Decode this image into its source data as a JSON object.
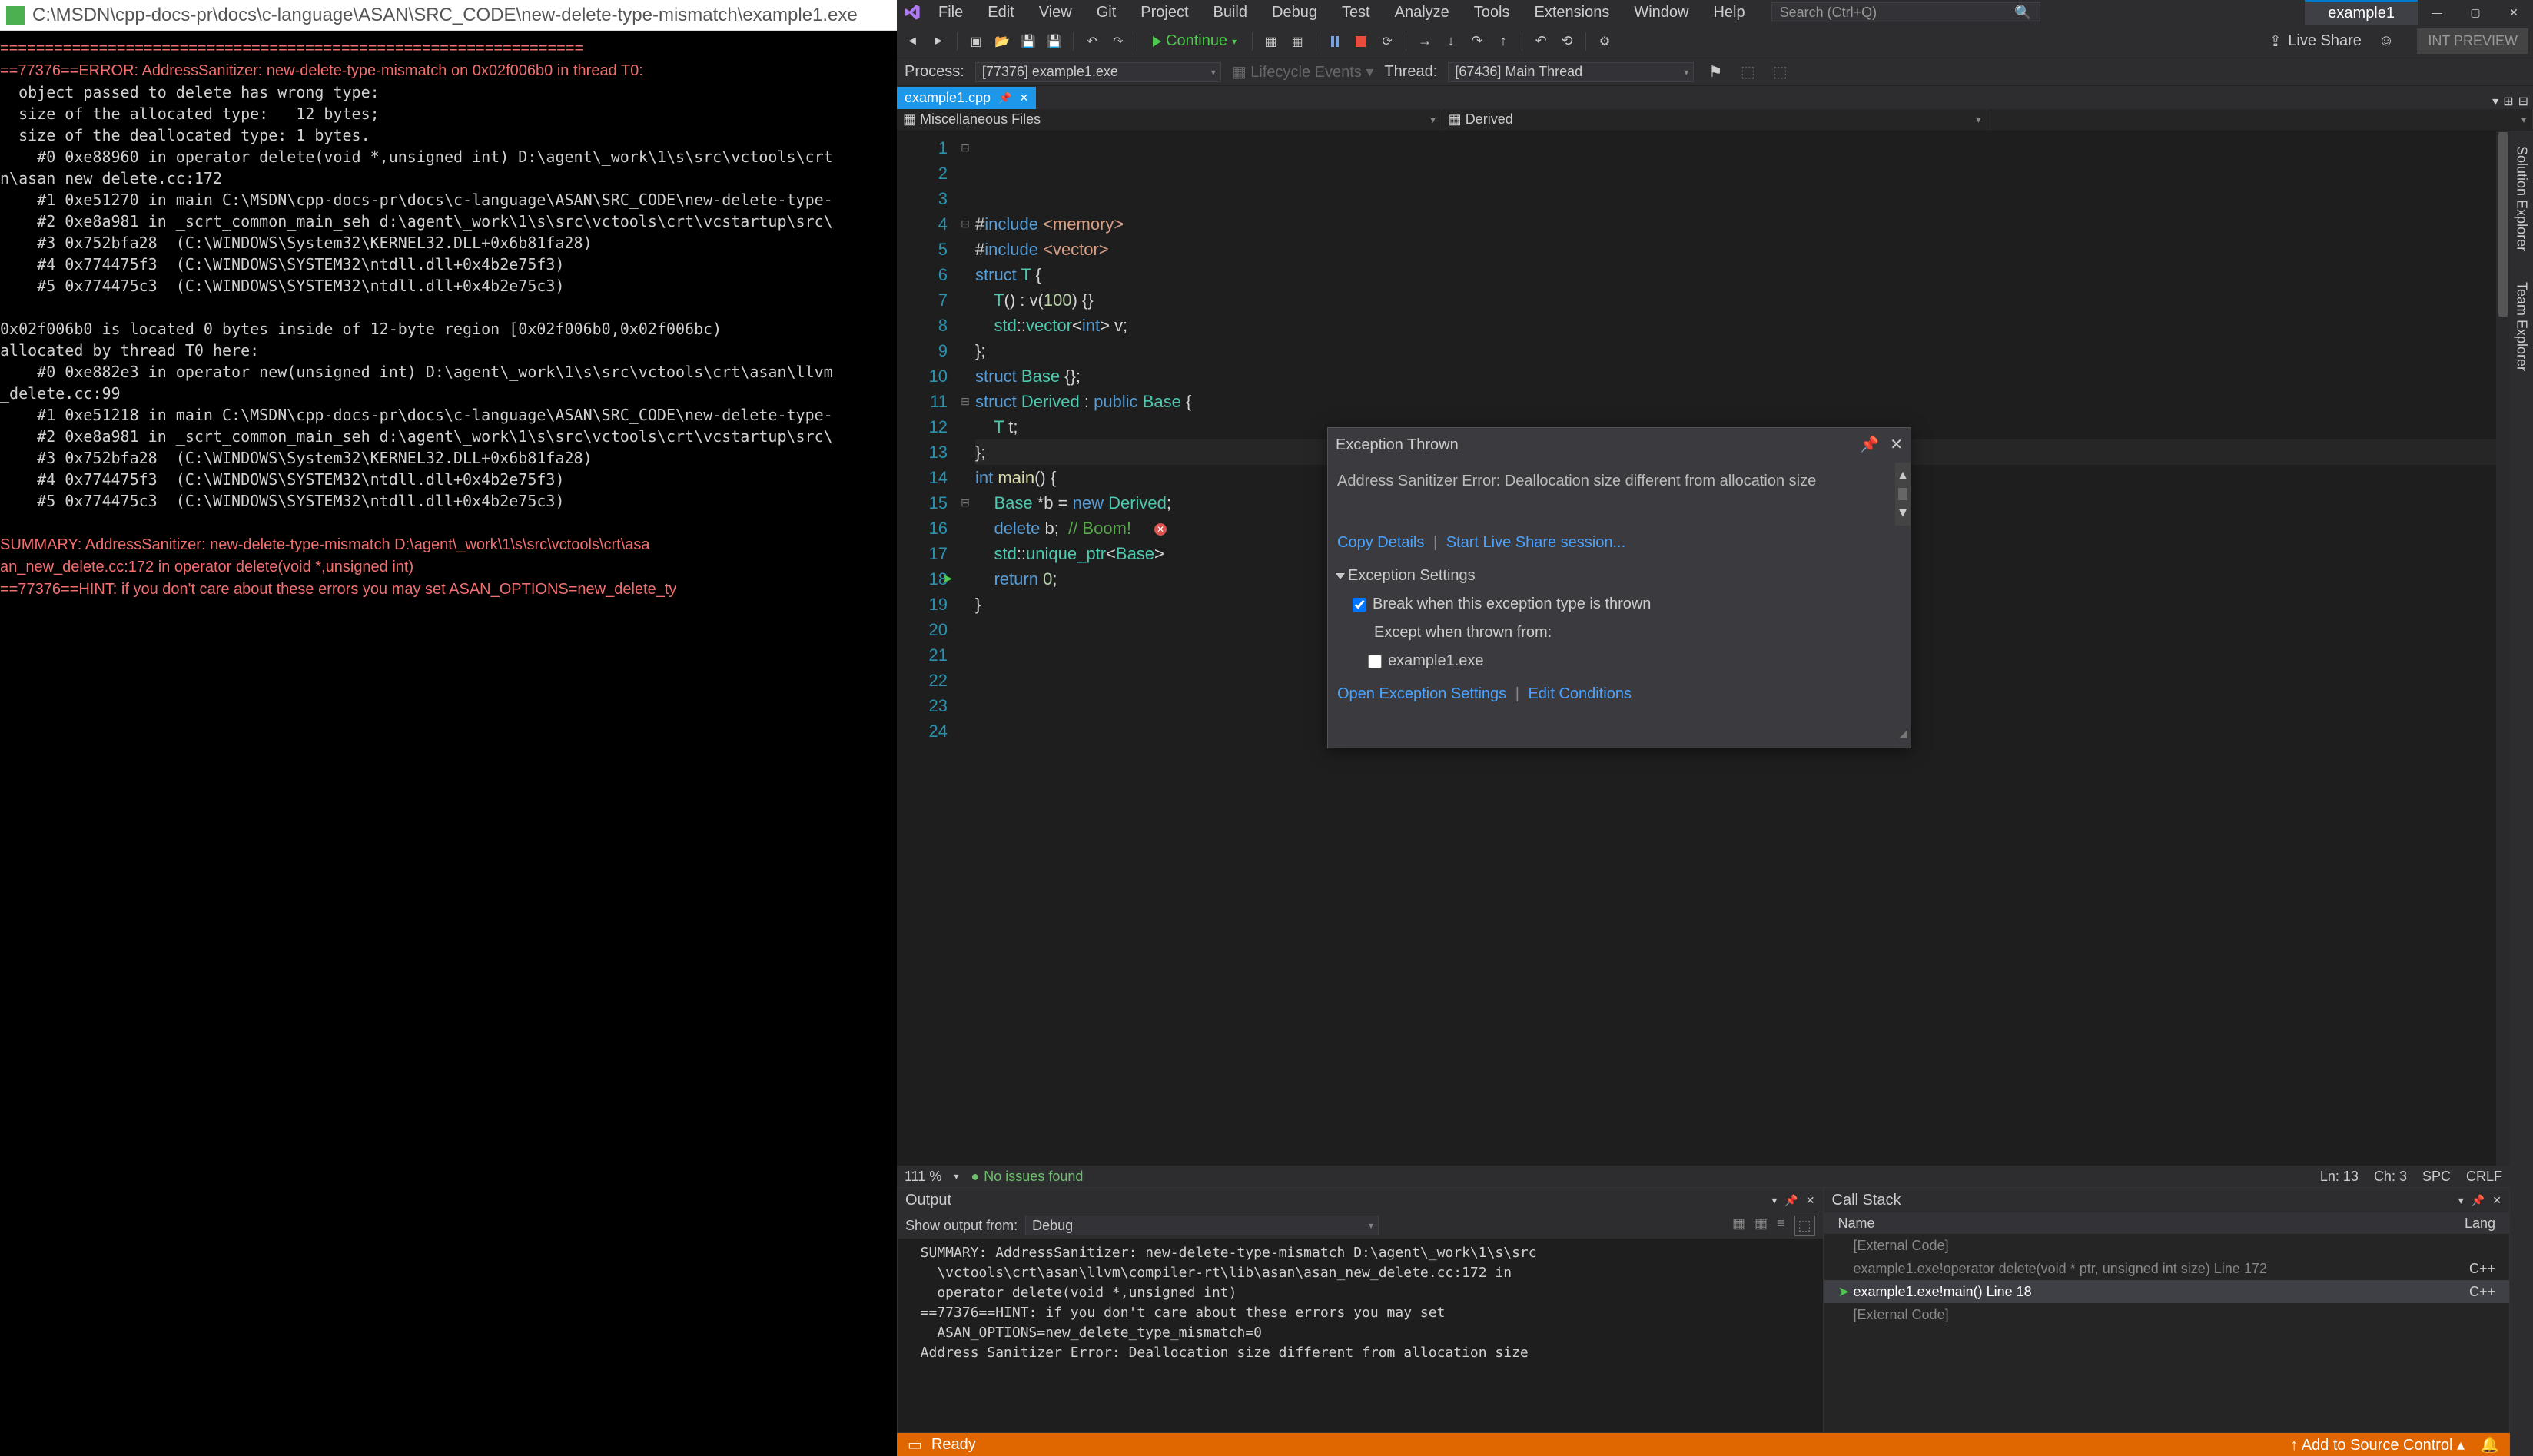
{
  "console": {
    "title_path": "C:\\MSDN\\cpp-docs-pr\\docs\\c-language\\ASAN\\SRC_CODE\\new-delete-type-mismatch\\example1.exe",
    "lines": [
      "=================================================================",
      "==77376==ERROR: AddressSanitizer: new-delete-type-mismatch on 0x02f006b0 in thread T0:",
      "  object passed to delete has wrong type:",
      "  size of the allocated type:   12 bytes;",
      "  size of the deallocated type: 1 bytes.",
      "    #0 0xe88960 in operator delete(void *,unsigned int) D:\\agent\\_work\\1\\s\\src\\vctools\\crt",
      "n\\asan_new_delete.cc:172",
      "    #1 0xe51270 in main C:\\MSDN\\cpp-docs-pr\\docs\\c-language\\ASAN\\SRC_CODE\\new-delete-type-",
      "    #2 0xe8a981 in _scrt_common_main_seh d:\\agent\\_work\\1\\s\\src\\vctools\\crt\\vcstartup\\src\\",
      "    #3 0x752bfa28  (C:\\WINDOWS\\System32\\KERNEL32.DLL+0x6b81fa28)",
      "    #4 0x774475f3  (C:\\WINDOWS\\SYSTEM32\\ntdll.dll+0x4b2e75f3)",
      "    #5 0x774475c3  (C:\\WINDOWS\\SYSTEM32\\ntdll.dll+0x4b2e75c3)",
      "",
      "0x02f006b0 is located 0 bytes inside of 12-byte region [0x02f006b0,0x02f006bc)",
      "allocated by thread T0 here:",
      "    #0 0xe882e3 in operator new(unsigned int) D:\\agent\\_work\\1\\s\\src\\vctools\\crt\\asan\\llvm",
      "_delete.cc:99",
      "    #1 0xe51218 in main C:\\MSDN\\cpp-docs-pr\\docs\\c-language\\ASAN\\SRC_CODE\\new-delete-type-",
      "    #2 0xe8a981 in _scrt_common_main_seh d:\\agent\\_work\\1\\s\\src\\vctools\\crt\\vcstartup\\src\\",
      "    #3 0x752bfa28  (C:\\WINDOWS\\System32\\KERNEL32.DLL+0x6b81fa28)",
      "    #4 0x774475f3  (C:\\WINDOWS\\SYSTEM32\\ntdll.dll+0x4b2e75f3)",
      "    #5 0x774475c3  (C:\\WINDOWS\\SYSTEM32\\ntdll.dll+0x4b2e75c3)",
      "",
      "SUMMARY: AddressSanitizer: new-delete-type-mismatch D:\\agent\\_work\\1\\s\\src\\vctools\\crt\\asa",
      "an_new_delete.cc:172 in operator delete(void *,unsigned int)",
      "==77376==HINT: if you don't care about these errors you may set ASAN_OPTIONS=new_delete_ty"
    ]
  },
  "vs": {
    "menu": [
      "File",
      "Edit",
      "View",
      "Git",
      "Project",
      "Build",
      "Debug",
      "Test",
      "Analyze",
      "Tools",
      "Extensions",
      "Window",
      "Help"
    ],
    "search_placeholder": "Search (Ctrl+Q)",
    "solution_tab": "example1",
    "toolbar": {
      "continue": "Continue",
      "live_share": "Live Share",
      "int_preview": "INT PREVIEW"
    },
    "procbar": {
      "process_label": "Process:",
      "process_value": "[77376] example1.exe",
      "lifecycle": "Lifecycle Events",
      "thread_label": "Thread:",
      "thread_value": "[67436] Main Thread"
    },
    "tab_name": "example1.cpp",
    "nav_left": "Miscellaneous Files",
    "nav_mid": "Derived",
    "editor_status": {
      "zoom": "111 %",
      "issues": "No issues found",
      "ln": "Ln: 13",
      "ch": "Ch: 3",
      "spc": "SPC",
      "crlf": "CRLF"
    },
    "side_tabs": [
      "Solution Explorer",
      "Team Explorer"
    ],
    "exception": {
      "title": "Exception Thrown",
      "msg": "Address Sanitizer Error: Deallocation size different from allocation size",
      "copy": "Copy Details",
      "live": "Start Live Share session...",
      "settings_hdr": "Exception Settings",
      "break_label": "Break when this exception type is thrown",
      "except_label": "Except when thrown from:",
      "except_item": "example1.exe",
      "open_settings": "Open Exception Settings",
      "edit_cond": "Edit Conditions"
    },
    "output": {
      "title": "Output",
      "show_from": "Show output from:",
      "source": "Debug",
      "body": "  SUMMARY: AddressSanitizer: new-delete-type-mismatch D:\\agent\\_work\\1\\s\\src\n    \\vctools\\crt\\asan\\llvm\\compiler-rt\\lib\\asan\\asan_new_delete.cc:172 in\n    operator delete(void *,unsigned int)\n  ==77376==HINT: if you don't care about these errors you may set\n    ASAN_OPTIONS=new_delete_type_mismatch=0\n  Address Sanitizer Error: Deallocation size different from allocation size"
    },
    "callstack": {
      "title": "Call Stack",
      "col_name": "Name",
      "col_lang": "Lang",
      "rows": [
        {
          "name": "[External Code]",
          "lang": "",
          "active": false
        },
        {
          "name": "example1.exe!operator delete(void * ptr, unsigned int size) Line 172",
          "lang": "C++",
          "active": false
        },
        {
          "name": "example1.exe!main() Line 18",
          "lang": "C++",
          "active": true
        },
        {
          "name": "[External Code]",
          "lang": "",
          "active": false
        }
      ]
    },
    "status": {
      "ready": "Ready",
      "add_src": "Add to Source Control"
    }
  }
}
